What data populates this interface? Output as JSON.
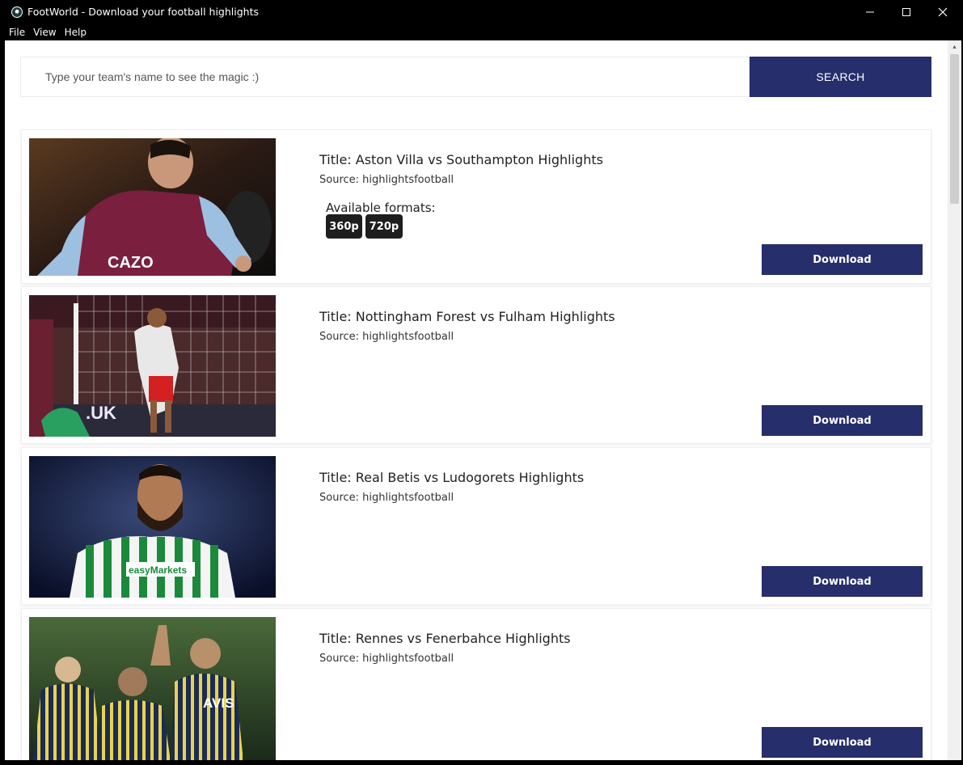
{
  "window": {
    "title": "FootWorld - Download your football highlights",
    "controls": {
      "minimize": "—",
      "maximize": "☐",
      "close": "✕"
    }
  },
  "menu": {
    "items": [
      "File",
      "View",
      "Help"
    ]
  },
  "search": {
    "placeholder": "Type your team's name to see the magic :)",
    "value": "",
    "button_label": "SEARCH"
  },
  "colors": {
    "accent": "#262e6b",
    "chip": "#1e1e1e"
  },
  "results": [
    {
      "title": "Title: Aston Villa vs Southampton Highlights",
      "source": "Source: highlightsfootball",
      "formats_label": "Available formats:",
      "formats": [
        "360p",
        "720p"
      ],
      "download_label": "Download",
      "thumb_text": "CAZO"
    },
    {
      "title": "Title: Nottingham Forest vs Fulham Highlights",
      "source": "Source: highlightsfootball",
      "download_label": "Download",
      "thumb_text": ".UK"
    },
    {
      "title": "Title: Real Betis vs Ludogorets Highlights",
      "source": "Source: highlightsfootball",
      "download_label": "Download",
      "thumb_text": "easyMarkets"
    },
    {
      "title": "Title: Rennes vs Fenerbahce Highlights",
      "source": "Source: highlightsfootball",
      "download_label": "Download",
      "thumb_text": "AVIS"
    }
  ]
}
